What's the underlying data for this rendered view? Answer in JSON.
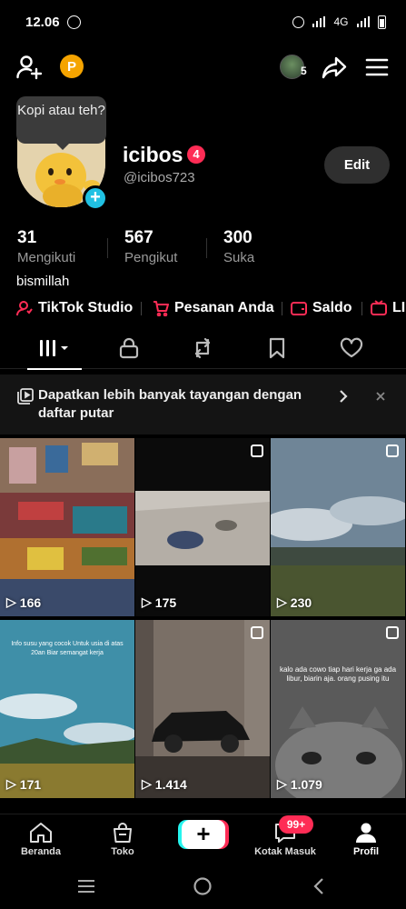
{
  "status_bar": {
    "time": "12.06",
    "network": "4G",
    "icons": [
      "whatsapp-icon",
      "alarm-icon",
      "signal-icon",
      "battery-icon"
    ]
  },
  "top_bar": {
    "coin_label": "P",
    "follow_request_count": "5",
    "icons": [
      "add-friend-icon",
      "share-icon",
      "menu-icon"
    ]
  },
  "tooltip": {
    "text": "Kopi atau teh?"
  },
  "profile": {
    "display_name": "icibos",
    "badge_count": "4",
    "handle": "@icibos723",
    "edit_label": "Edit",
    "bio": "bismillah"
  },
  "stats": [
    {
      "value": "31",
      "label": "Mengikuti"
    },
    {
      "value": "567",
      "label": "Pengikut"
    },
    {
      "value": "300",
      "label": "Suka"
    }
  ],
  "quick_links": [
    {
      "label": "TikTok Studio",
      "icon": "studio-icon"
    },
    {
      "label": "Pesanan Anda",
      "icon": "cart-icon"
    },
    {
      "label": "Saldo",
      "icon": "wallet-icon"
    },
    {
      "label": "LI",
      "icon": "live-icon"
    }
  ],
  "tabs": [
    "videos-grid-icon",
    "lock-icon",
    "repost-icon",
    "bookmark-icon",
    "heart-icon"
  ],
  "promo": {
    "text": "Dapatkan lebih banyak tayangan dengan daftar putar"
  },
  "videos": [
    {
      "views": "166",
      "caption": ""
    },
    {
      "views": "175",
      "caption": ""
    },
    {
      "views": "230",
      "caption": ""
    },
    {
      "views": "171",
      "caption": "Info susu yang cocok Untuk usia di atas 20an Biar semangat kerja"
    },
    {
      "views": "1.414",
      "caption": ""
    },
    {
      "views": "1.079",
      "caption": "kalo ada cowo tiap hari kerja ga ada libur, biarin aja. orang pusing itu"
    }
  ],
  "bottom_nav": {
    "items": [
      "Beranda",
      "Toko",
      "Kotak Masuk",
      "Profil"
    ],
    "inbox_badge": "99+",
    "create_label": "+"
  },
  "colors": {
    "accent": "#fe2c55",
    "cyan": "#25f4ee",
    "coin": "#f5a400",
    "background": "#000000"
  }
}
